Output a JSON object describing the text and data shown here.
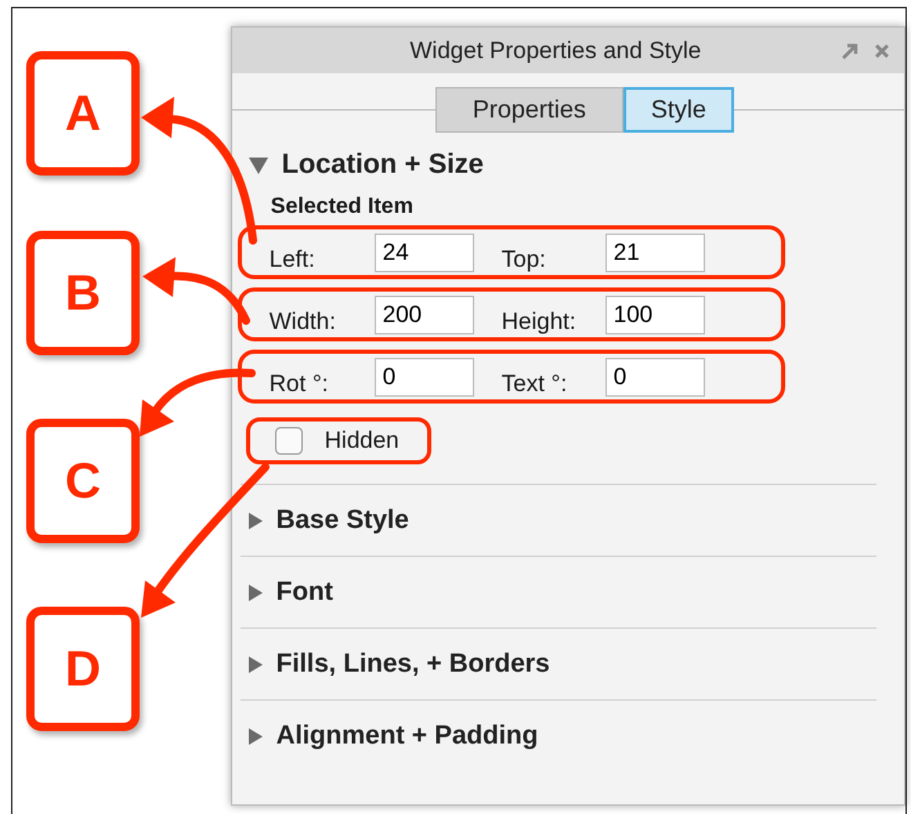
{
  "callouts": [
    "A",
    "B",
    "C",
    "D"
  ],
  "panel": {
    "title": "Widget Properties and Style",
    "tabs": [
      {
        "label": "Properties",
        "selected": false
      },
      {
        "label": "Style",
        "selected": true
      }
    ],
    "sections": [
      {
        "title": "Location + Size",
        "expanded": true
      },
      {
        "title": "Base Style",
        "expanded": false
      },
      {
        "title": "Font",
        "expanded": false
      },
      {
        "title": "Fills, Lines, + Borders",
        "expanded": false
      },
      {
        "title": "Alignment + Padding",
        "expanded": false
      }
    ],
    "selected_item": {
      "heading": "Selected Item",
      "rows": [
        [
          {
            "label": "Left:",
            "value": "24"
          },
          {
            "label": "Top:",
            "value": "21"
          }
        ],
        [
          {
            "label": "Width:",
            "value": "200"
          },
          {
            "label": "Height:",
            "value": "100"
          }
        ],
        [
          {
            "label": "Rot °:",
            "value": "0"
          },
          {
            "label": "Text °:",
            "value": "0"
          }
        ]
      ],
      "hidden": {
        "label": "Hidden",
        "checked": false
      }
    }
  }
}
